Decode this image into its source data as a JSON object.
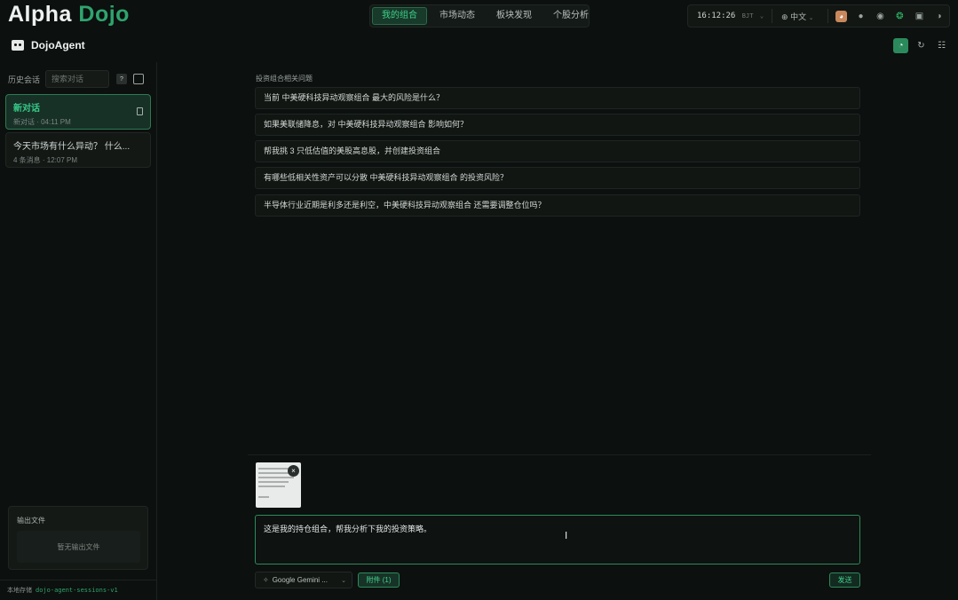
{
  "app": {
    "logo_part1": "Alpha",
    "logo_part2": "Dojo"
  },
  "nav": {
    "tabs": [
      {
        "label": "我的组合",
        "active": true
      },
      {
        "label": "市场动态",
        "active": false
      },
      {
        "label": "板块发现",
        "active": false
      },
      {
        "label": "个股分析",
        "active": false
      }
    ]
  },
  "status": {
    "time": "16:12:26",
    "timezone": "BJT",
    "language": "中文",
    "icons": [
      "avatar-icon",
      "github-icon",
      "discord-icon",
      "wechat-icon",
      "book-icon",
      "theme-icon"
    ]
  },
  "agent": {
    "title": "DojoAgent",
    "header_icons": [
      "chat-icon",
      "refresh-icon",
      "layout-icon"
    ]
  },
  "sidebar": {
    "history_label": "历史会话",
    "search_placeholder": "搜索对话",
    "help_label": "?",
    "conversations": [
      {
        "title": "新对话",
        "meta": "新对话 · 04:11 PM",
        "active": true
      },
      {
        "title": "今天市场有什么异动？ 什么...",
        "meta": "4 条消息 · 12:07 PM",
        "active": false
      }
    ],
    "output_files": {
      "title": "输出文件",
      "empty_text": "暂无输出文件"
    },
    "footer": {
      "label": "本地存储",
      "code": "dojo-agent-sessions-v1"
    }
  },
  "main": {
    "suggestions_title": "投资组合相关问题",
    "suggestions": [
      "当前 中美硬科技异动观察组合 最大的风险是什么？",
      "如果美联储降息，对 中美硬科技异动观察组合 影响如何？",
      "帮我挑 3 只低估值的美股高息股，并创建投资组合",
      "有哪些低相关性资产可以分散 中美硬科技异动观察组合 的投资风险？",
      "半导体行业近期是利多还是利空，中美硬科技异动观察组合 还需要调整仓位吗？"
    ]
  },
  "composer": {
    "message": "这是我的持仓组合，帮我分析下我的投资策略。",
    "model": "Google Gemini ...",
    "attach_label": "附件 (1)",
    "send_label": "发送"
  },
  "colors": {
    "accent": "#2fa36e",
    "background": "#0c100e"
  }
}
